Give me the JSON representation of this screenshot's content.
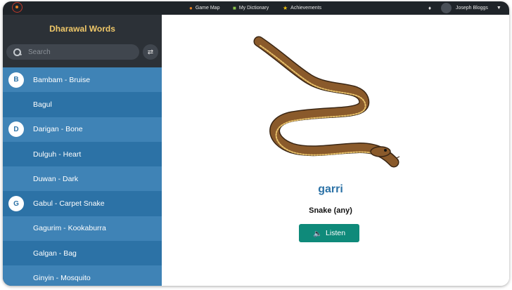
{
  "topbar": {
    "nav": [
      {
        "label": "Game Map",
        "icon": "map-pin-icon",
        "color": "#e67e22"
      },
      {
        "label": "My Dictionary",
        "icon": "book-icon",
        "color": "#8bc34a"
      },
      {
        "label": "Achievements",
        "icon": "star-icon",
        "color": "#f1c40f"
      }
    ],
    "notification_icon": "bell-icon",
    "user_name": "Joseph Bloggs"
  },
  "sidebar": {
    "title": "Dharawal Words",
    "search_placeholder": "Search",
    "shuffle_icon": "shuffle-icon",
    "items": [
      {
        "letter": "B",
        "label": "Bambam - Bruise"
      },
      {
        "letter": "",
        "label": "Bagul"
      },
      {
        "letter": "D",
        "label": "Darigan - Bone"
      },
      {
        "letter": "",
        "label": "Dulguh - Heart"
      },
      {
        "letter": "",
        "label": "Duwan - Dark"
      },
      {
        "letter": "G",
        "label": "Gabul - Carpet Snake"
      },
      {
        "letter": "",
        "label": "Gagurim - Kookaburra"
      },
      {
        "letter": "",
        "label": "Galgan - Bag"
      },
      {
        "letter": "",
        "label": "Ginyin - Mosquito"
      }
    ]
  },
  "main": {
    "word": "garri",
    "translation": "Snake (any)",
    "listen_label": "Listen",
    "image": "snake-illustration"
  },
  "colors": {
    "accent": "#2c72a6",
    "listen_button": "#0f8a7a",
    "title": "#f0c869"
  }
}
